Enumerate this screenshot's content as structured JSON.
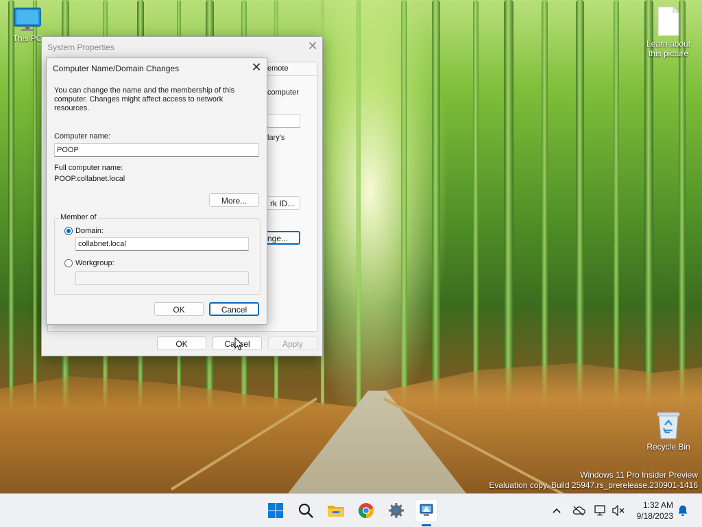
{
  "desktop": {
    "icons": [
      {
        "label": "This PC"
      },
      {
        "label": "Learn about this picture"
      },
      {
        "label": "Recycle Bin"
      }
    ],
    "watermark": {
      "line1": "Windows 11 Pro Insider Preview",
      "line2": "Evaluation copy. Build 25947.rs_prerelease.230901-1416"
    }
  },
  "system_properties": {
    "title": "System Properties",
    "tab_fragment": "emote",
    "fragment_computer": "computer",
    "fragment_lary": "lary's",
    "fragment_network_id_button": "rk ID...",
    "fragment_change_button": "nge...",
    "ok_label": "OK",
    "cancel_label": "Cancel",
    "apply_label": "Apply"
  },
  "dialog": {
    "title": "Computer Name/Domain Changes",
    "description": "You can change the name and the membership of this computer. Changes might affect access to network resources.",
    "computer_name_label": "Computer name:",
    "computer_name_value": "POOP",
    "full_name_label": "Full computer name:",
    "full_name_value": "POOP.collabnet.local",
    "more_label": "More...",
    "member_of_label": "Member of",
    "domain_label": "Domain:",
    "domain_value": "collabnet.local",
    "domain_selected": true,
    "workgroup_label": "Workgroup:",
    "workgroup_value": "",
    "ok_label": "OK",
    "cancel_label": "Cancel"
  },
  "taskbar": {
    "apps": [
      "windows-start",
      "search",
      "file-explorer",
      "chrome",
      "settings",
      "system-properties"
    ],
    "active_app": "system-properties",
    "clock_time": "1:32 AM",
    "clock_date": "9/18/2023"
  },
  "colors": {
    "accent": "#0067c0"
  }
}
